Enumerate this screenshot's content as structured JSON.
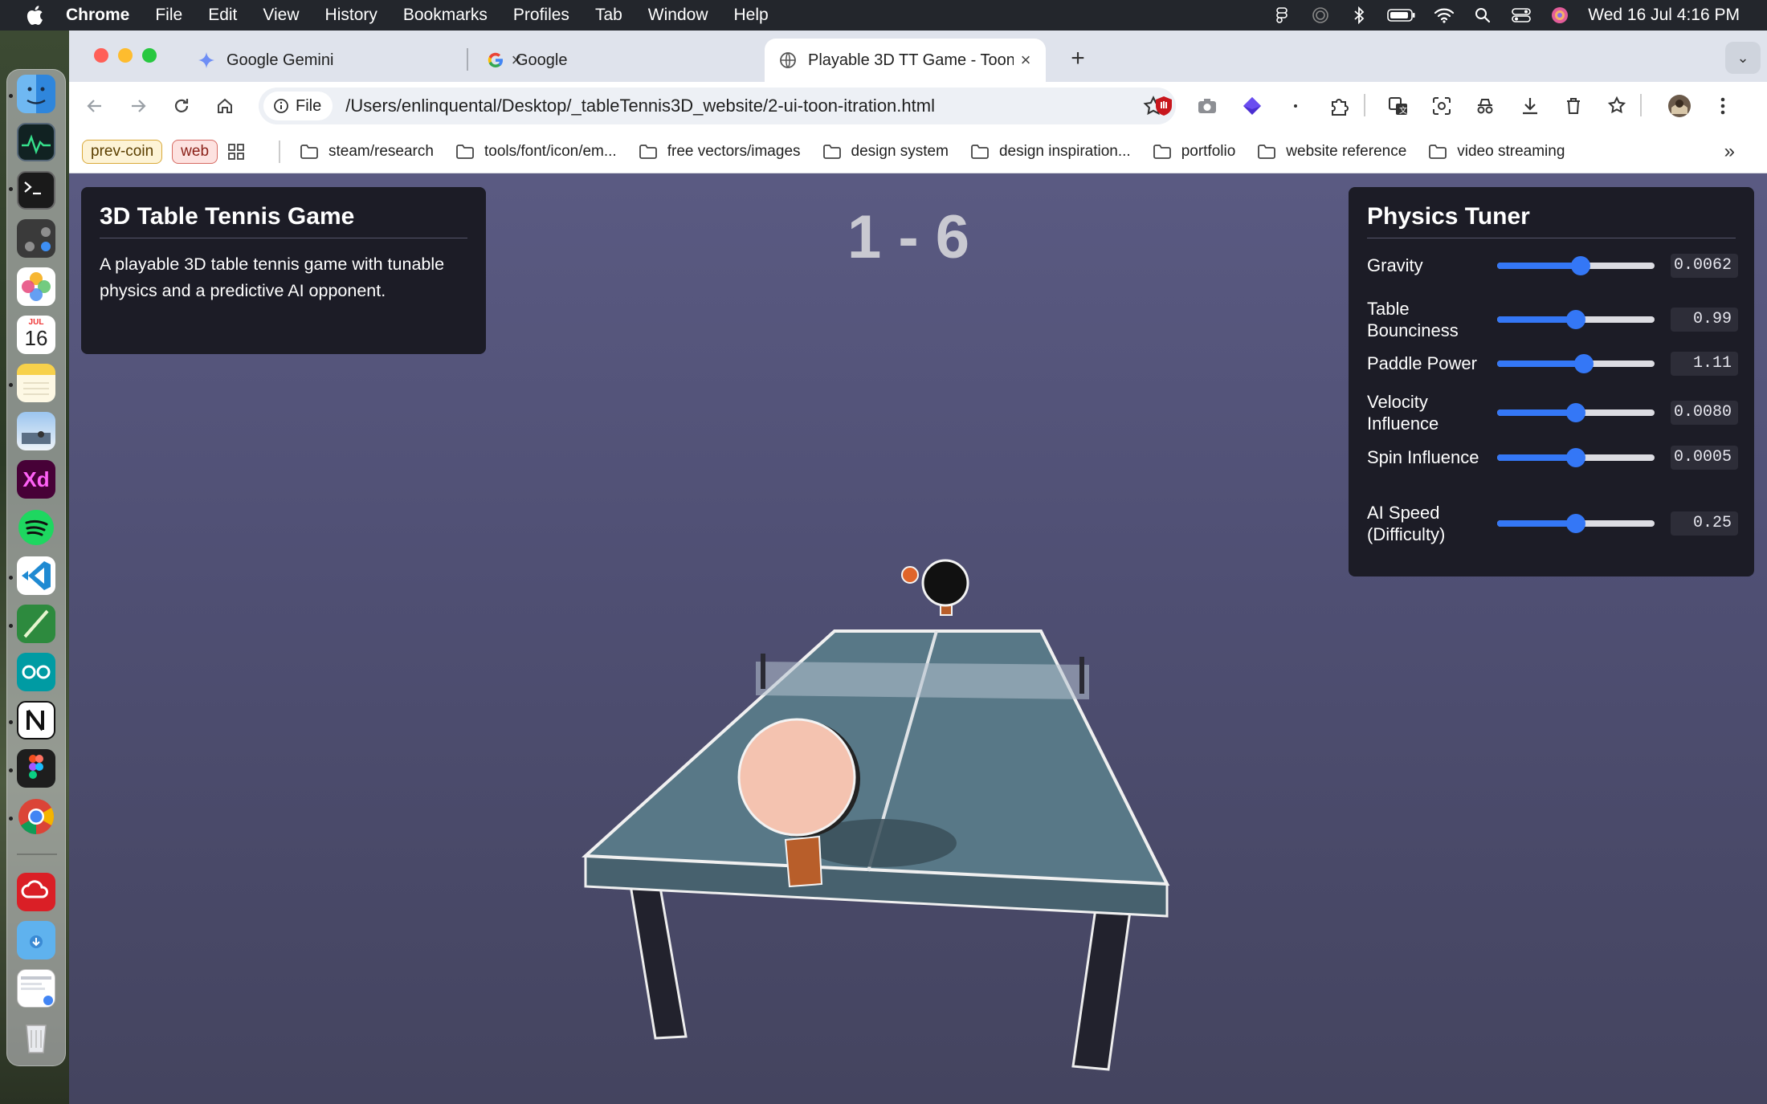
{
  "menubar": {
    "app": "Chrome",
    "items": [
      "File",
      "Edit",
      "View",
      "History",
      "Bookmarks",
      "Profiles",
      "Tab",
      "Window",
      "Help"
    ],
    "clock": "Wed 16 Jul  4:16 PM"
  },
  "dock": {
    "calendar_month": "JUL",
    "calendar_day": "16",
    "xd_label": "Xd"
  },
  "tabs": [
    {
      "title": "Google Gemini",
      "icon": "gemini-icon",
      "close": "×"
    },
    {
      "title": "Google",
      "icon": "google-icon",
      "close": "×"
    },
    {
      "title": "Playable 3D TT Game - Toon",
      "icon": "globe-icon",
      "close": "×"
    }
  ],
  "toolbar": {
    "scheme_label": "File",
    "url": "/Users/enlinquental/Desktop/_tableTennis3D_website/2-ui-toon-itration.html",
    "new_tab": "+",
    "tab_search": "⌄"
  },
  "bookmarks": {
    "badges": [
      "prev-coin",
      "web"
    ],
    "folders": [
      "steam/research",
      "tools/font/icon/em...",
      "free vectors/images",
      "design system",
      "design inspiration...",
      "portfolio",
      "website reference",
      "video streaming"
    ],
    "more": "»"
  },
  "page": {
    "info": {
      "title": "3D Table Tennis Game",
      "description": "A playable 3D table tennis game with tunable physics and a predictive AI opponent."
    },
    "score": "1 - 6",
    "tuner": {
      "title": "Physics Tuner",
      "params": [
        {
          "label": "Gravity",
          "value": "0.0062",
          "fraction": 0.53
        },
        {
          "label": "Table Bounciness",
          "value": "0.99",
          "fraction": 0.5
        },
        {
          "label": "Paddle Power",
          "value": "1.11",
          "fraction": 0.55
        },
        {
          "label": "Velocity Influence",
          "value": "0.0080",
          "fraction": 0.5
        },
        {
          "label": "Spin Influence",
          "value": "0.0005",
          "fraction": 0.5
        },
        {
          "label": "AI Speed (Difficulty)",
          "value": "0.25",
          "fraction": 0.5
        }
      ]
    }
  },
  "colors": {
    "accent": "#3477f6",
    "panel_bg": "#1c1c26",
    "scene_bg": "#55557a",
    "table": "#4e7180",
    "ball": "#e0642a",
    "player_paddle": "#f4c3b0",
    "opponent_paddle": "#111111",
    "handle": "#b85e2a"
  }
}
